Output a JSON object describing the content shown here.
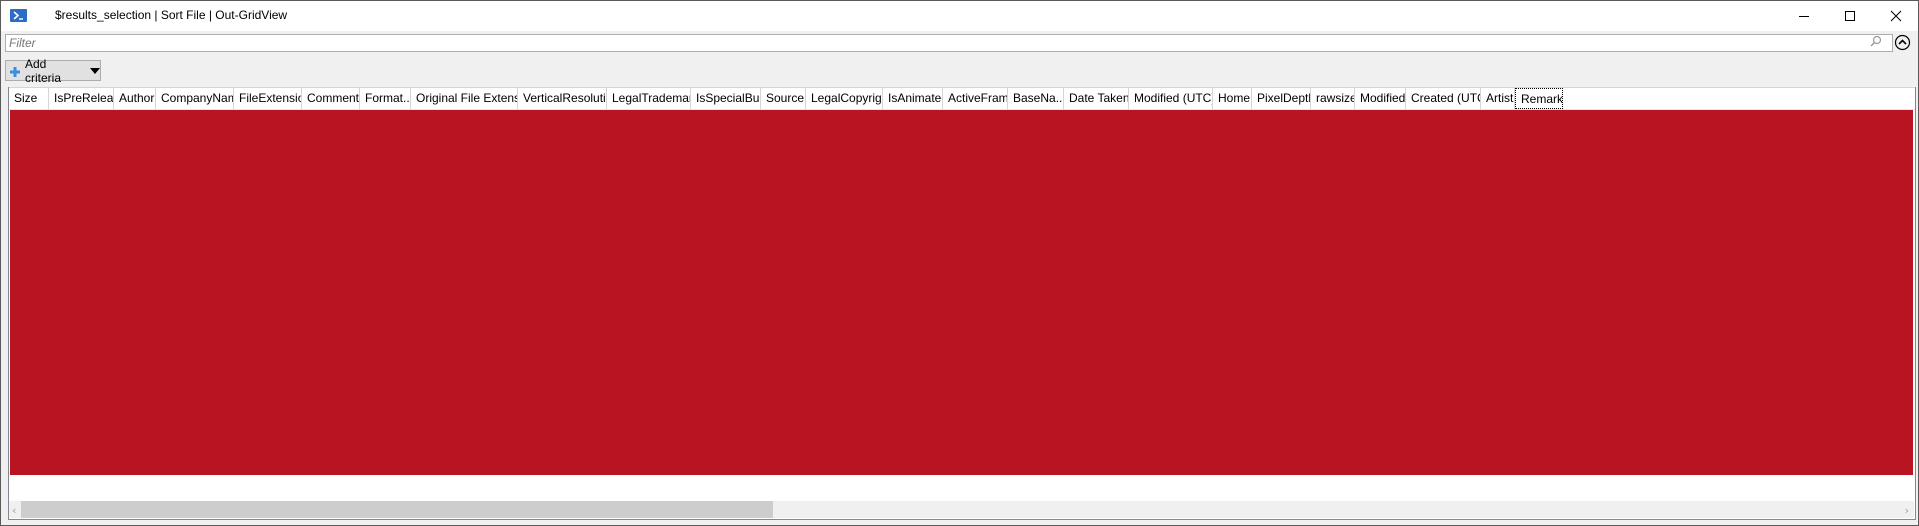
{
  "window": {
    "title": "$results_selection | Sort File | Out-GridView",
    "app_icon": "powershell-icon",
    "controls": {
      "minimize": "minimize-icon",
      "maximize": "maximize-icon",
      "close": "close-icon"
    }
  },
  "filter": {
    "placeholder": "Filter",
    "value": "",
    "search_icon": "search-icon",
    "collapse_icon": "chevron-up-circle-icon"
  },
  "toolbar": {
    "add_criteria_label": "Add criteria",
    "add_criteria_icon": "plus-icon",
    "dropdown_icon": "caret-down-icon"
  },
  "grid": {
    "columns": [
      {
        "label": "Size"
      },
      {
        "label": "IsPreRelease"
      },
      {
        "label": "Author"
      },
      {
        "label": "CompanyName"
      },
      {
        "label": "FileExtension"
      },
      {
        "label": "Comments"
      },
      {
        "label": "Format..."
      },
      {
        "label": "Original File Extension"
      },
      {
        "label": "VerticalResolution"
      },
      {
        "label": "LegalTrademarks"
      },
      {
        "label": "IsSpecialBuild"
      },
      {
        "label": "Source"
      },
      {
        "label": "LegalCopyright"
      },
      {
        "label": "IsAnimated"
      },
      {
        "label": "ActiveFrame"
      },
      {
        "label": "BaseNa..."
      },
      {
        "label": "Date Taken"
      },
      {
        "label": "Modified (UTC)"
      },
      {
        "label": "Home"
      },
      {
        "label": "PixelDepth"
      },
      {
        "label": "rawsize"
      },
      {
        "label": "Modified"
      },
      {
        "label": "Created (UTC)"
      },
      {
        "label": "Artist"
      },
      {
        "label": "Remarks"
      }
    ],
    "focused_column": "Remarks",
    "rows_redacted": true,
    "redaction_color": "#b81421"
  },
  "scrollbar": {
    "horizontal_position_fraction": 0.0,
    "visible_fraction": 0.4
  }
}
